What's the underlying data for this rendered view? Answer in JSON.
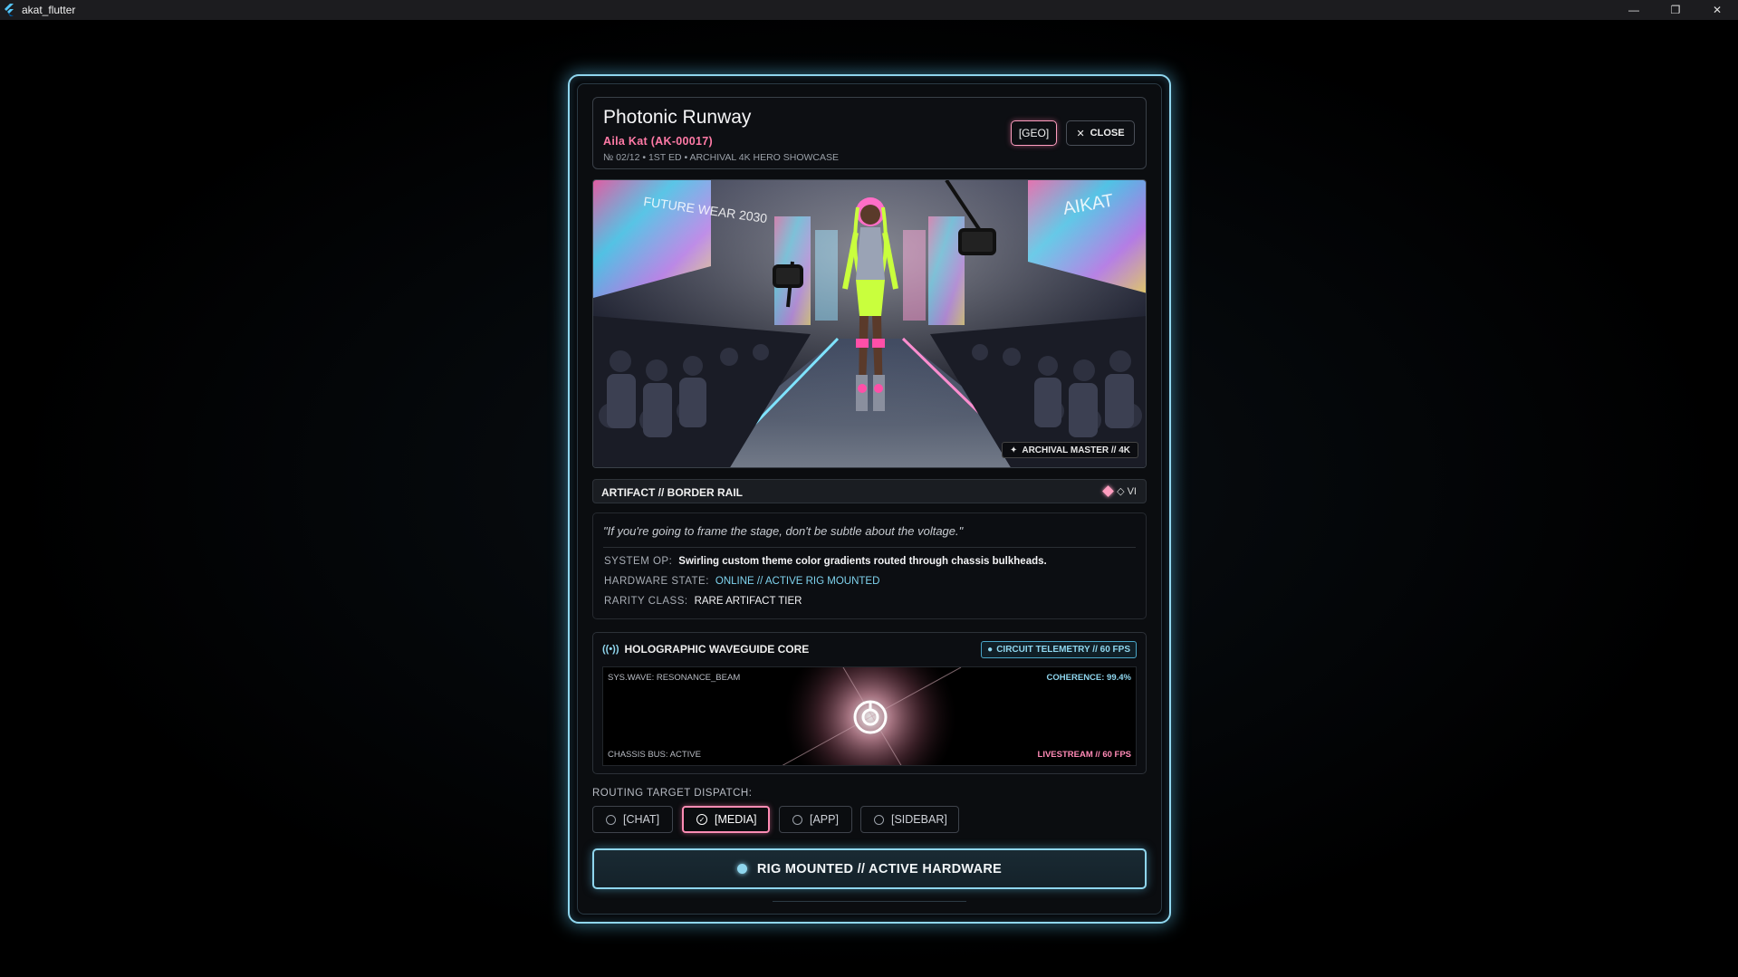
{
  "window": {
    "title": "akat_flutter",
    "minimize_glyph": "—",
    "restore_glyph": "❐",
    "close_glyph": "✕"
  },
  "header": {
    "title": "Photonic Runway",
    "subtitle": "Aila Kat (AK-00017)",
    "meta": "№ 02/12 • 1ST ED • ARCHIVAL 4K HERO SHOWCASE",
    "geo_label": "[GEO]",
    "close_label": "CLOSE"
  },
  "hero": {
    "left_screen_text": "FUTURE WEAR 2030",
    "right_screen_text": "AIKAT",
    "badge": "ARCHIVAL MASTER // 4K"
  },
  "artifact": {
    "label": "ARTIFACT // BORDER RAIL",
    "tier": "◇ VI"
  },
  "info": {
    "quote": "\"If you're going to frame the stage, don't be subtle about the voltage.\"",
    "system_op_key": "SYSTEM OP:",
    "system_op_value": "Swirling custom theme color gradients routed through chassis bulkheads.",
    "hardware_state_key": "HARDWARE STATE:",
    "hardware_state_value": "ONLINE // ACTIVE RIG MOUNTED",
    "rarity_key": "RARITY CLASS:",
    "rarity_value": "RARE ARTIFACT TIER"
  },
  "waveguide": {
    "title": "HOLOGRAPHIC WAVEGUIDE CORE",
    "telemetry": "CIRCUIT TELEMETRY // 60 FPS",
    "sys_wave": "SYS.WAVE: RESONANCE_BEAM",
    "coherence": "COHERENCE: 99.4%",
    "chassis_bus": "CHASSIS BUS: ACTIVE",
    "livestream": "LIVESTREAM // 60 FPS"
  },
  "routing": {
    "label": "ROUTING TARGET DISPATCH:",
    "options": [
      {
        "label": "[CHAT]",
        "selected": false
      },
      {
        "label": "[MEDIA]",
        "selected": true
      },
      {
        "label": "[APP]",
        "selected": false
      },
      {
        "label": "[SIDEBAR]",
        "selected": false
      }
    ]
  },
  "main_button": {
    "label": "RIG MOUNTED // ACTIVE HARDWARE"
  },
  "colors": {
    "accent_cyan": "#8fd6ee",
    "accent_pink": "#ff7aa6",
    "background": "#000000"
  },
  "icons": {
    "app": "flutter-logo-icon",
    "close": "x-icon",
    "badge": "sparkle-icon",
    "tier": "diamond-icon",
    "waveguide": "antenna-icon",
    "core": "power-icon"
  }
}
